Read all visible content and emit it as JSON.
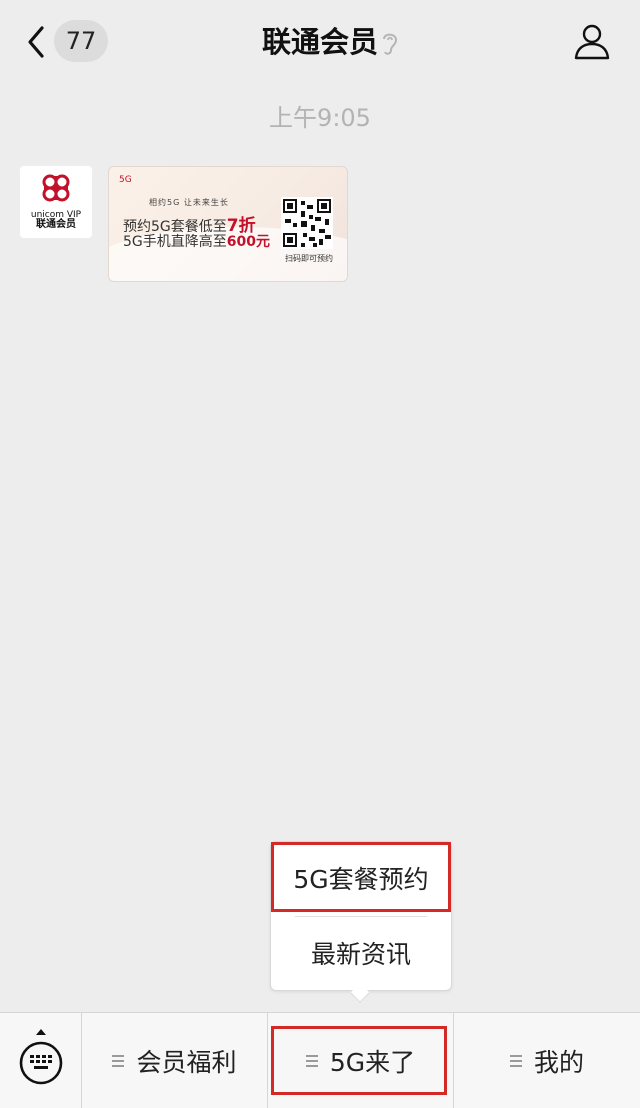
{
  "header": {
    "back_count": "77",
    "title": "联通会员"
  },
  "timestamp": "上午9:05",
  "avatar": {
    "brand_en": "unicom VIP",
    "brand_cn": "联通会员"
  },
  "card": {
    "logo": "5G",
    "tagline": "相约5G 让未来生长",
    "line1_prefix": "预约5G套餐低至",
    "line1_highlight": "7折",
    "line2_prefix": "5G手机直降高至",
    "line2_highlight": "600元",
    "qr_caption": "扫码即可预约"
  },
  "popup": {
    "items": [
      "5G套餐预约",
      "最新资讯"
    ]
  },
  "bottom_menu": {
    "items": [
      "会员福利",
      "5G来了",
      "我的"
    ]
  },
  "colors": {
    "brand_red": "#c3112b",
    "annotation_red": "#d42a25",
    "background": "#ededed"
  }
}
